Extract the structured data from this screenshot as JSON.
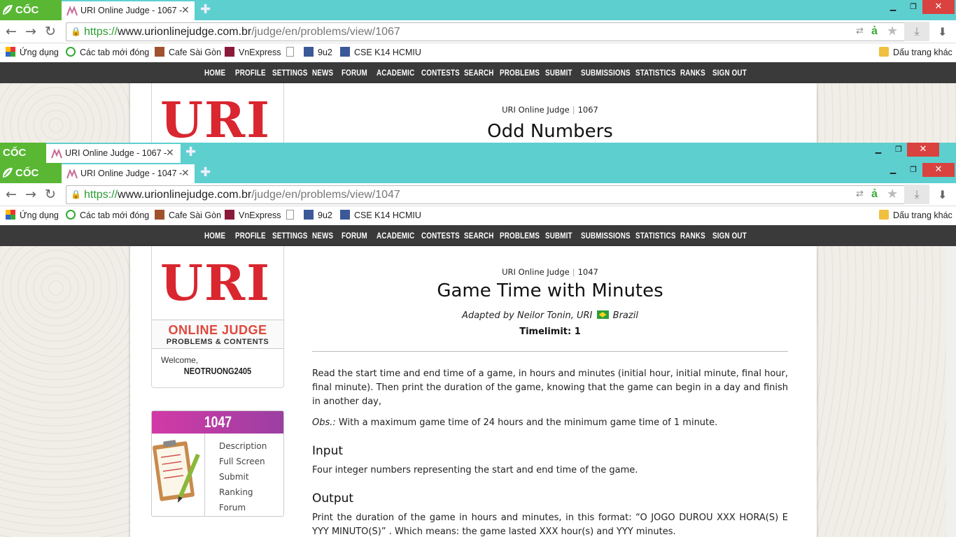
{
  "browser": {
    "logo_text": "CỐC CỐC"
  },
  "window1": {
    "tab_title": "URI Online Judge - 1067 -",
    "url_scheme": "https://",
    "url_host": "www.urionlinejudge.com.br",
    "url_path": "/judge/en/problems/view/1067",
    "breadcrumb_site": "URI Online Judge",
    "breadcrumb_id": "1067",
    "problem_title": "Odd Numbers"
  },
  "window2": {
    "tab_title": "URI Online Judge - 1067 -"
  },
  "window3": {
    "tab_title": "URI Online Judge - 1047 -",
    "url_scheme": "https://",
    "url_host": "www.urionlinejudge.com.br",
    "url_path": "/judge/en/problems/view/1047"
  },
  "bookmarks": {
    "apps": "Ứng dụng",
    "closed_tabs": "Các tab mới đóng",
    "cafe": "Cafe Sài Gòn",
    "vnexpress": "VnExpress",
    "nineu2": "9u2",
    "cse": "CSE K14 HCMIU",
    "other": "Dấu trang khác"
  },
  "menu": [
    "HOME",
    "PROFILE",
    "SETTINGS",
    "NEWS",
    "FORUM",
    "ACADEMIC",
    "CONTESTS",
    "SEARCH",
    "PROBLEMS",
    "SUBMIT",
    "SUBMISSIONS",
    "STATISTICS",
    "RANKS",
    "SIGN OUT"
  ],
  "sidebar": {
    "logo_text": "URI",
    "online_judge": "ONLINE JUDGE",
    "tagline": "PROBLEMS & CONTENTS",
    "welcome": "Welcome,",
    "username": "NEOTRUONG2405",
    "problem_id": "1047",
    "links": [
      "Description",
      "Full Screen",
      "Submit",
      "Ranking",
      "Forum"
    ]
  },
  "problem": {
    "breadcrumb_site": "URI Online Judge",
    "breadcrumb_id": "1047",
    "title": "Game Time with Minutes",
    "author_prefix": "Adapted by Neilor Tonin, URI",
    "author_country": "Brazil",
    "timelimit": "Timelimit: 1",
    "description": "Read the start time and end time of a game, in hours and minutes (initial hour, initial minute, final hour, final minute). Then print the duration of the game, knowing that the game can begin in a day and finish in another day,",
    "obs_label": "Obs.:",
    "obs_text": " With a maximum game time of 24 hours and the minimum game time of 1 minute.",
    "input_heading": "Input",
    "input_text": "Four integer numbers representing the start and end time of the game.",
    "output_heading": "Output",
    "output_text": "Print the duration of the game in hours and minutes, in this format: “O JOGO DUROU XXX HORA(S) E YYY MINUTO(S)” . Which means: the game lasted XXX hour(s) and YYY minutes."
  }
}
